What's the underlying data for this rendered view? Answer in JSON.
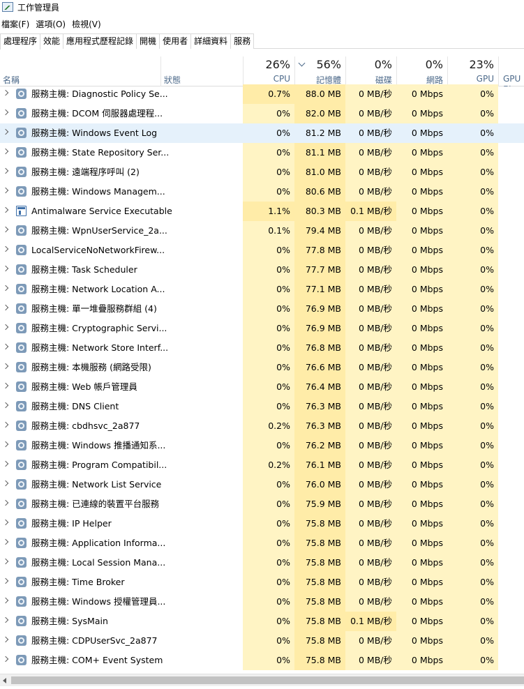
{
  "window": {
    "title": "工作管理員"
  },
  "menu": [
    "檔案(F)",
    "選項(O)",
    "檢視(V)"
  ],
  "tabs": [
    "處理程序",
    "效能",
    "應用程式歷程記錄",
    "開機",
    "使用者",
    "詳細資料",
    "服務"
  ],
  "active_tab": 0,
  "columns": {
    "name": {
      "label": "名稱"
    },
    "status": {
      "label": "狀態"
    },
    "cpu": {
      "pct": "26%",
      "label": "CPU"
    },
    "memory": {
      "pct": "56%",
      "label": "記憶體"
    },
    "disk": {
      "pct": "0%",
      "label": "磁碟"
    },
    "network": {
      "pct": "0%",
      "label": "網路"
    },
    "gpu": {
      "pct": "23%",
      "label": "GPU"
    },
    "gpu_engine": {
      "label": "GPU 引"
    }
  },
  "heat_colors": {
    "light": "#fff4c4",
    "medium": "#ffeca8",
    "selected": "#e5f1fb"
  },
  "processes": [
    {
      "name": "服務主機: Diagnostic Policy Se...",
      "icon": "gear-icon",
      "cpu": "0.7%",
      "mem": "88.0 MB",
      "disk": "0 MB/秒",
      "net": "0 Mbps",
      "gpu": "0%"
    },
    {
      "name": "服務主機: DCOM 伺服器處理程...",
      "icon": "gear-icon",
      "cpu": "0%",
      "mem": "82.0 MB",
      "disk": "0 MB/秒",
      "net": "0 Mbps",
      "gpu": "0%"
    },
    {
      "name": "服務主機: Windows Event Log",
      "icon": "gear-icon",
      "cpu": "0%",
      "mem": "81.2 MB",
      "disk": "0 MB/秒",
      "net": "0 Mbps",
      "gpu": "0%",
      "selected": true
    },
    {
      "name": "服務主機: State Repository Ser...",
      "icon": "gear-icon",
      "cpu": "0%",
      "mem": "81.1 MB",
      "disk": "0 MB/秒",
      "net": "0 Mbps",
      "gpu": "0%"
    },
    {
      "name": "服務主機: 遠端程序呼叫 (2)",
      "icon": "gear-icon",
      "cpu": "0%",
      "mem": "81.0 MB",
      "disk": "0 MB/秒",
      "net": "0 Mbps",
      "gpu": "0%"
    },
    {
      "name": "服務主機: Windows Managem...",
      "icon": "gear-icon",
      "cpu": "0%",
      "mem": "80.6 MB",
      "disk": "0 MB/秒",
      "net": "0 Mbps",
      "gpu": "0%"
    },
    {
      "name": "Antimalware Service Executable",
      "icon": "app-window-icon",
      "cpu": "1.1%",
      "mem": "80.3 MB",
      "disk": "0.1 MB/秒",
      "net": "0 Mbps",
      "gpu": "0%"
    },
    {
      "name": "服務主機: WpnUserService_2a...",
      "icon": "gear-icon",
      "cpu": "0.1%",
      "mem": "79.4 MB",
      "disk": "0 MB/秒",
      "net": "0 Mbps",
      "gpu": "0%"
    },
    {
      "name": "LocalServiceNoNetworkFirew...",
      "icon": "gear-icon",
      "cpu": "0%",
      "mem": "77.8 MB",
      "disk": "0 MB/秒",
      "net": "0 Mbps",
      "gpu": "0%"
    },
    {
      "name": "服務主機: Task Scheduler",
      "icon": "gear-icon",
      "cpu": "0%",
      "mem": "77.7 MB",
      "disk": "0 MB/秒",
      "net": "0 Mbps",
      "gpu": "0%"
    },
    {
      "name": "服務主機: Network Location A...",
      "icon": "gear-icon",
      "cpu": "0%",
      "mem": "77.1 MB",
      "disk": "0 MB/秒",
      "net": "0 Mbps",
      "gpu": "0%"
    },
    {
      "name": "服務主機: 單一堆疊服務群組 (4)",
      "icon": "gear-icon",
      "cpu": "0%",
      "mem": "76.9 MB",
      "disk": "0 MB/秒",
      "net": "0 Mbps",
      "gpu": "0%"
    },
    {
      "name": "服務主機: Cryptographic Servi...",
      "icon": "gear-icon",
      "cpu": "0%",
      "mem": "76.9 MB",
      "disk": "0 MB/秒",
      "net": "0 Mbps",
      "gpu": "0%"
    },
    {
      "name": "服務主機: Network Store Interf...",
      "icon": "gear-icon",
      "cpu": "0%",
      "mem": "76.8 MB",
      "disk": "0 MB/秒",
      "net": "0 Mbps",
      "gpu": "0%"
    },
    {
      "name": "服務主機: 本機服務 (網路受限)",
      "icon": "gear-icon",
      "cpu": "0%",
      "mem": "76.6 MB",
      "disk": "0 MB/秒",
      "net": "0 Mbps",
      "gpu": "0%"
    },
    {
      "name": "服務主機: Web 帳戶管理員",
      "icon": "gear-icon",
      "cpu": "0%",
      "mem": "76.4 MB",
      "disk": "0 MB/秒",
      "net": "0 Mbps",
      "gpu": "0%"
    },
    {
      "name": "服務主機: DNS Client",
      "icon": "gear-icon",
      "cpu": "0%",
      "mem": "76.3 MB",
      "disk": "0 MB/秒",
      "net": "0 Mbps",
      "gpu": "0%"
    },
    {
      "name": "服務主機: cbdhsvc_2a877",
      "icon": "gear-icon",
      "cpu": "0.2%",
      "mem": "76.3 MB",
      "disk": "0 MB/秒",
      "net": "0 Mbps",
      "gpu": "0%"
    },
    {
      "name": "服務主機: Windows 推播通知系...",
      "icon": "gear-icon",
      "cpu": "0%",
      "mem": "76.2 MB",
      "disk": "0 MB/秒",
      "net": "0 Mbps",
      "gpu": "0%"
    },
    {
      "name": "服務主機: Program Compatibil...",
      "icon": "gear-icon",
      "cpu": "0.2%",
      "mem": "76.1 MB",
      "disk": "0 MB/秒",
      "net": "0 Mbps",
      "gpu": "0%"
    },
    {
      "name": "服務主機: Network List Service",
      "icon": "gear-icon",
      "cpu": "0%",
      "mem": "76.0 MB",
      "disk": "0 MB/秒",
      "net": "0 Mbps",
      "gpu": "0%"
    },
    {
      "name": "服務主機: 已連線的裝置平台服務",
      "icon": "gear-icon",
      "cpu": "0%",
      "mem": "75.9 MB",
      "disk": "0 MB/秒",
      "net": "0 Mbps",
      "gpu": "0%"
    },
    {
      "name": "服務主機: IP Helper",
      "icon": "gear-icon",
      "cpu": "0%",
      "mem": "75.8 MB",
      "disk": "0 MB/秒",
      "net": "0 Mbps",
      "gpu": "0%"
    },
    {
      "name": "服務主機: Application Informa...",
      "icon": "gear-icon",
      "cpu": "0%",
      "mem": "75.8 MB",
      "disk": "0 MB/秒",
      "net": "0 Mbps",
      "gpu": "0%"
    },
    {
      "name": "服務主機: Local Session Mana...",
      "icon": "gear-icon",
      "cpu": "0%",
      "mem": "75.8 MB",
      "disk": "0 MB/秒",
      "net": "0 Mbps",
      "gpu": "0%"
    },
    {
      "name": "服務主機: Time Broker",
      "icon": "gear-icon",
      "cpu": "0%",
      "mem": "75.8 MB",
      "disk": "0 MB/秒",
      "net": "0 Mbps",
      "gpu": "0%"
    },
    {
      "name": "服務主機: Windows 授權管理員...",
      "icon": "gear-icon",
      "cpu": "0%",
      "mem": "75.8 MB",
      "disk": "0 MB/秒",
      "net": "0 Mbps",
      "gpu": "0%"
    },
    {
      "name": "服務主機: SysMain",
      "icon": "gear-icon",
      "cpu": "0%",
      "mem": "75.8 MB",
      "disk": "0.1 MB/秒",
      "net": "0 Mbps",
      "gpu": "0%"
    },
    {
      "name": "服務主機: CDPUserSvc_2a877",
      "icon": "gear-icon",
      "cpu": "0%",
      "mem": "75.8 MB",
      "disk": "0 MB/秒",
      "net": "0 Mbps",
      "gpu": "0%"
    },
    {
      "name": "服務主機: COM+ Event System",
      "icon": "gear-icon",
      "cpu": "0%",
      "mem": "75.8 MB",
      "disk": "0 MB/秒",
      "net": "0 Mbps",
      "gpu": "0%"
    }
  ]
}
